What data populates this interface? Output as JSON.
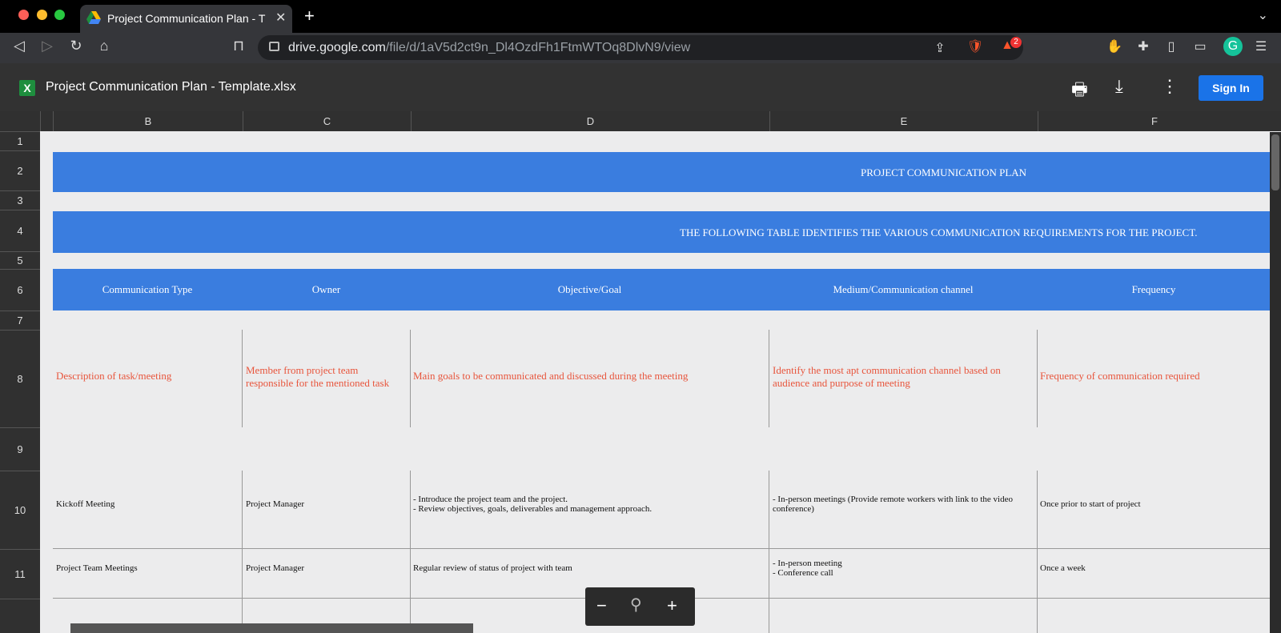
{
  "browser": {
    "tab_title": "Project Communication Plan - T",
    "url_domain": "drive.google.com",
    "url_path": "/file/d/1aV5d2ct9n_Dl4OzdFh1FtmWTOq8DlvN9/view",
    "badge_count": "2"
  },
  "drive": {
    "file_title": "Project Communication Plan - Template.xlsx",
    "sign_in_label": "Sign In"
  },
  "sheet": {
    "columns": [
      "B",
      "C",
      "D",
      "E",
      "F"
    ],
    "rows": [
      "1",
      "2",
      "3",
      "4",
      "5",
      "6",
      "7",
      "8",
      "9",
      "10",
      "11"
    ],
    "title": "PROJECT COMMUNICATION PLAN",
    "subtitle": "THE FOLLOWING TABLE IDENTIFIES THE VARIOUS COMMUNICATION REQUIREMENTS FOR THE PROJECT.",
    "headers": [
      "Communication Type",
      "Owner",
      "Objective/Goal",
      "Medium/Communication channel",
      "Frequency"
    ],
    "description_row": [
      "Description of task/meeting",
      "Member from project team responsible for the mentioned task",
      "Main goals to be communicated and discussed during the meeting",
      "Identify the most apt communication channel based on audience and purpose of meeting",
      "Frequency of communication required"
    ],
    "row10": [
      "Kickoff Meeting",
      "Project Manager",
      "- Introduce the project team and the project.\n- Review objectives, goals, deliverables and management approach.",
      "- In-person meetings (Provide remote workers with link to the video conference)",
      "Once prior to start of project"
    ],
    "row11": [
      "Project Team Meetings",
      "Project Manager",
      "Regular review of status of project with team",
      "- In-person meeting\n- Conference call",
      "Once a week"
    ]
  },
  "zoom": {
    "minus": "−",
    "plus": "+"
  }
}
